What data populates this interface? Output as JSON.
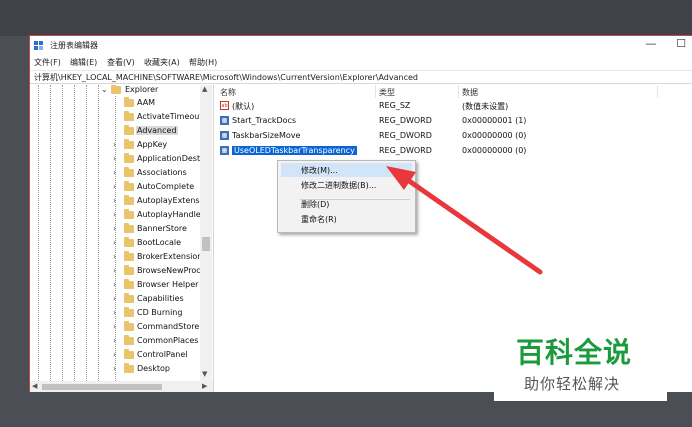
{
  "window": {
    "title": "注册表编辑器",
    "minimize_glyph": "—",
    "maximize_glyph": "☐"
  },
  "menu": [
    "文件(F)",
    "编辑(E)",
    "查看(V)",
    "收藏夹(A)",
    "帮助(H)"
  ],
  "address": "计算机\\HKEY_LOCAL_MACHINE\\SOFTWARE\\Microsoft\\Windows\\CurrentVersion\\Explorer\\Advanced",
  "tree": {
    "parent": "Explorer",
    "items": [
      "AAM",
      "ActivateTimeout",
      "Advanced",
      "AppKey",
      "ApplicationDest",
      "Associations",
      "AutoComplete",
      "AutoplayExtensi",
      "AutoplayHandle",
      "BannerStore",
      "BootLocale",
      "BrokerExtension",
      "BrowseNewProc",
      "Browser Helper",
      "Capabilities",
      "CD Burning",
      "CommandStore",
      "CommonPlaces",
      "ControlPanel",
      "Desktop"
    ],
    "selected": "Advanced"
  },
  "columns": {
    "name": "名称",
    "type": "类型",
    "data": "数据"
  },
  "values": [
    {
      "icon": "ab",
      "name": "(默认)",
      "type": "REG_SZ",
      "data": "(数值未设置)"
    },
    {
      "icon": "dword",
      "name": "Start_TrackDocs",
      "type": "REG_DWORD",
      "data": "0x00000001 (1)"
    },
    {
      "icon": "dword",
      "name": "TaskbarSizeMove",
      "type": "REG_DWORD",
      "data": "0x00000000 (0)"
    },
    {
      "icon": "dword",
      "name": "UseOLEDTaskbarTransparency",
      "type": "REG_DWORD",
      "data": "0x00000000 (0)"
    }
  ],
  "context_menu": {
    "modify": "修改(M)...",
    "modify_binary": "修改二进制数据(B)...",
    "delete": "删除(D)",
    "rename": "重命名(R)"
  },
  "watermark": {
    "title": "百科全说",
    "subtitle": "助你轻松解决"
  },
  "colors": {
    "accent_red": "#e8383b",
    "selection_blue": "#0a64d6",
    "watermark_green": "#1e9a3e"
  }
}
